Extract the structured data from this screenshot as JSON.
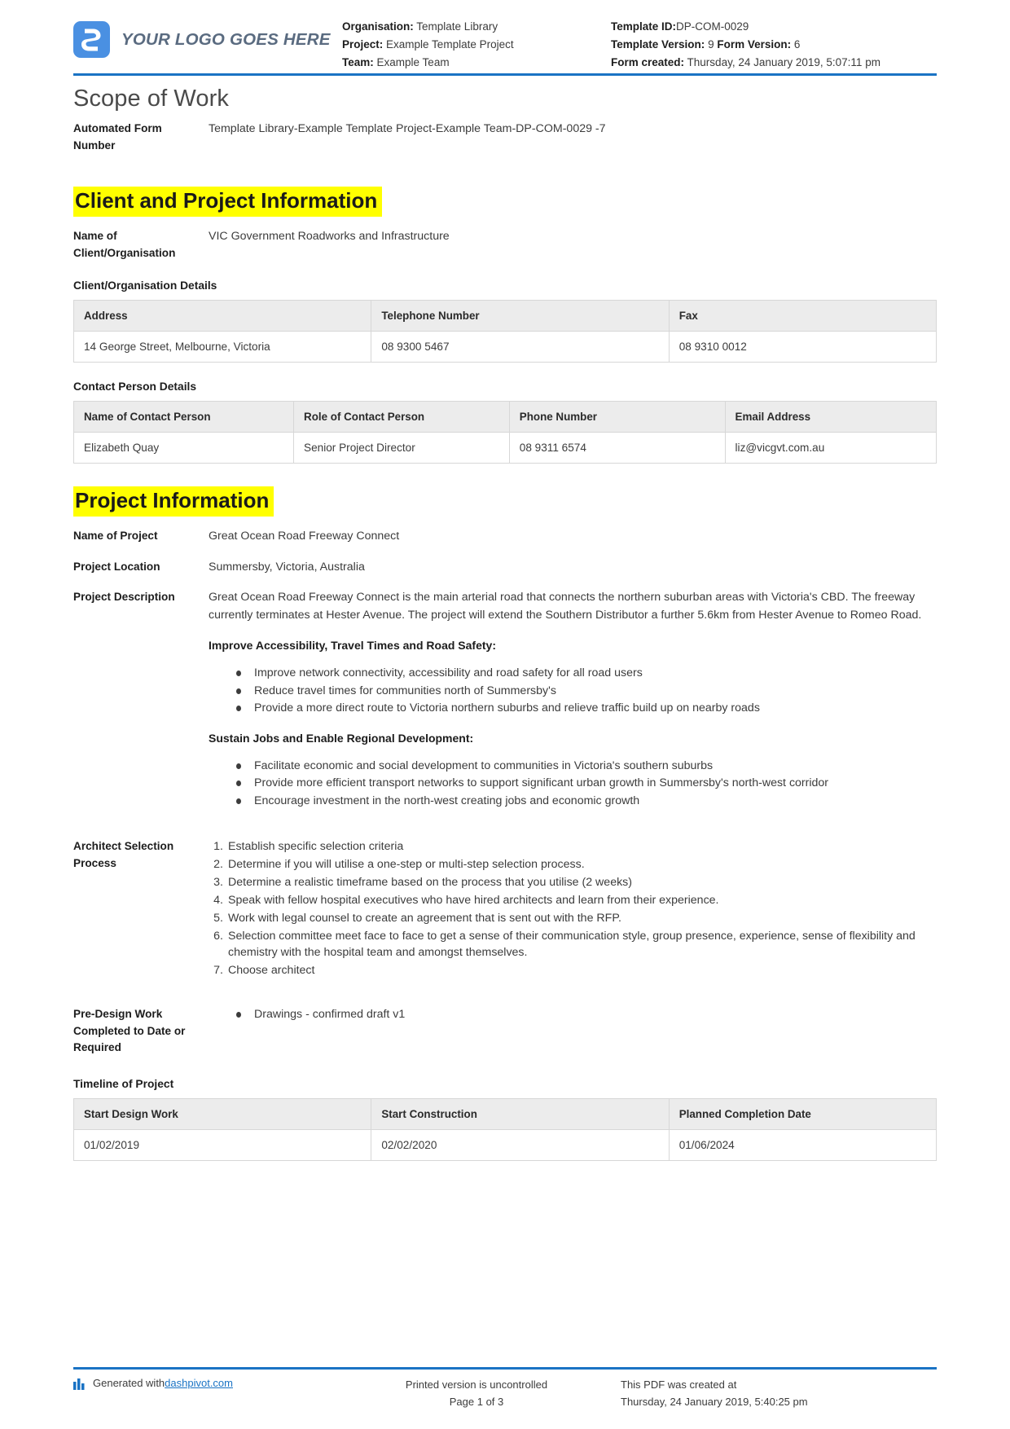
{
  "header": {
    "logo_text": "YOUR LOGO GOES HERE",
    "left": {
      "organisation_label": "Organisation:",
      "organisation_value": "Template Library",
      "project_label": "Project:",
      "project_value": "Example Template Project",
      "team_label": "Team:",
      "team_value": "Example Team"
    },
    "right": {
      "template_id_label": "Template ID:",
      "template_id_value": "DP-COM-0029",
      "template_version_label": "Template Version:",
      "template_version_value": "9",
      "form_version_label": "Form Version:",
      "form_version_value": "6",
      "form_created_label": "Form created:",
      "form_created_value": "Thursday, 24 January 2019, 5:07:11 pm"
    }
  },
  "document": {
    "title": "Scope of Work",
    "automated_form_number_label": "Automated Form Number",
    "automated_form_number_value": "Template Library-Example Template Project-Example Team-DP-COM-0029   -7"
  },
  "client_section": {
    "heading": "Client and Project Information",
    "name_of_client_label": "Name of Client/Organisation",
    "name_of_client_value": "VIC Government Roadworks and Infrastructure",
    "org_details_caption": "Client/Organisation Details",
    "org_details_headers": [
      "Address",
      "Telephone Number",
      "Fax"
    ],
    "org_details_row": [
      "14 George Street, Melbourne, Victoria",
      "08 9300 5467",
      "08 9310 0012"
    ],
    "contact_caption": "Contact Person Details",
    "contact_headers": [
      "Name of Contact Person",
      "Role of Contact Person",
      "Phone Number",
      "Email Address"
    ],
    "contact_row": [
      "Elizabeth Quay",
      "Senior Project Director",
      "08 9311 6574",
      "liz@vicgvt.com.au"
    ]
  },
  "project_section": {
    "heading": "Project Information",
    "name_label": "Name of Project",
    "name_value": "Great Ocean Road Freeway Connect",
    "location_label": "Project Location",
    "location_value": "Summersby, Victoria, Australia",
    "description_label": "Project Description",
    "description_paragraph": "Great Ocean Road Freeway Connect is the main arterial road that connects the northern suburban areas with Victoria's CBD. The freeway currently terminates at Hester Avenue. The project will extend the Southern Distributor a further 5.6km from Hester Avenue to Romeo Road.",
    "accessibility_heading": "Improve Accessibility, Travel Times and Road Safety:",
    "accessibility_bullets": [
      "Improve network connectivity, accessibility and road safety for all road users",
      "Reduce travel times for communities north of Summersby's",
      "Provide a more direct route to Victoria northern suburbs and relieve traffic build up on nearby roads"
    ],
    "jobs_heading": "Sustain Jobs and Enable Regional Development:",
    "jobs_bullets": [
      "Facilitate economic and social development to communities in Victoria's southern suburbs",
      "Provide more efficient transport networks to support significant urban growth in Summersby's north-west corridor",
      "Encourage investment in the north-west creating jobs and economic growth"
    ],
    "architect_label": "Architect Selection Process",
    "architect_steps": [
      "Establish specific selection criteria",
      "Determine if you will utilise a one-step or multi-step selection process.",
      "Determine a realistic timeframe based on the process that you utilise (2 weeks)",
      "Speak with fellow hospital executives who have hired architects and learn from their experience.",
      "Work with legal counsel to create an agreement that is sent out with the RFP.",
      "Selection committee meet face to face to get a sense of their communication style, group presence, experience, sense of flexibility and chemistry with the hospital team and amongst themselves.",
      "Choose architect"
    ],
    "predesign_label": "Pre-Design Work Completed to Date or Required",
    "predesign_bullets": [
      "Drawings - confirmed draft v1"
    ],
    "timeline_caption": "Timeline of Project",
    "timeline_headers": [
      "Start Design Work",
      "Start Construction",
      "Planned Completion Date"
    ],
    "timeline_row": [
      "01/02/2019",
      "02/02/2020",
      "01/06/2024"
    ]
  },
  "footer": {
    "generated_prefix": "Generated with ",
    "generated_link": "dashpivot.com",
    "uncontrolled_line": "Printed version is uncontrolled",
    "page_line": "Page 1 of 3",
    "created_line_1": "This PDF was created at",
    "created_line_2": "Thursday, 24 January 2019, 5:40:25 pm"
  },
  "colors": {
    "accent_blue": "#1a73c4",
    "logo_blue": "#4a90e2",
    "highlight_yellow": "#ffff00",
    "table_header_grey": "#ececec"
  }
}
